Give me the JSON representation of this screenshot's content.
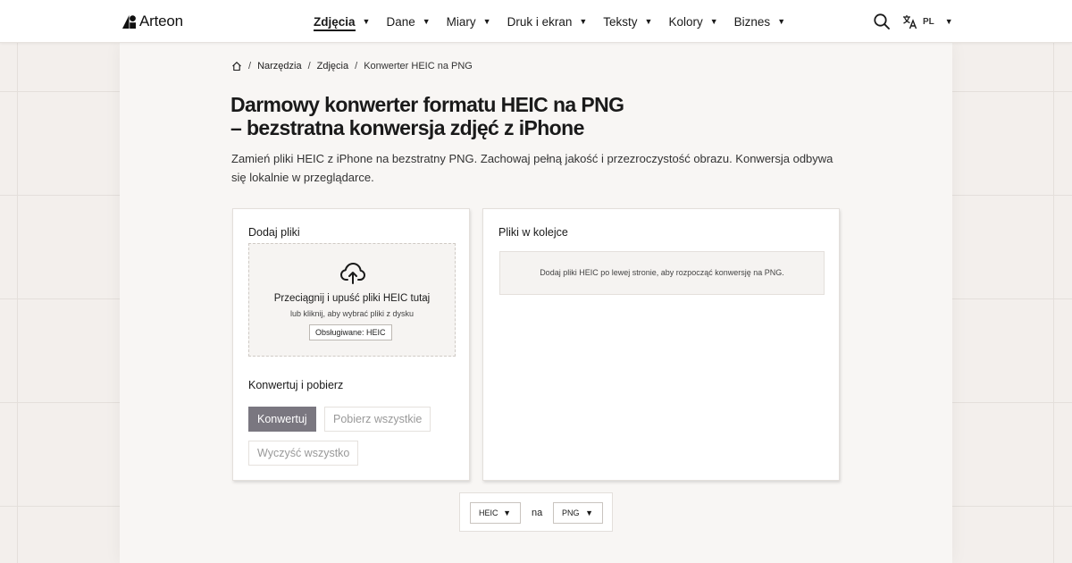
{
  "header": {
    "brand": "Arteon",
    "nav": [
      {
        "label": "Zdjęcia",
        "active": true
      },
      {
        "label": "Dane"
      },
      {
        "label": "Miary"
      },
      {
        "label": "Druk i ekran"
      },
      {
        "label": "Teksty"
      },
      {
        "label": "Kolory"
      },
      {
        "label": "Biznes"
      }
    ],
    "caret": "▼",
    "lang": "PL",
    "icons": [
      "logo-icon",
      "search-icon",
      "translate-icon",
      "home-icon",
      "upload-cloud-icon"
    ]
  },
  "breadcrumb": {
    "items": [
      "Narzędzia",
      "Zdjęcia"
    ],
    "current": "Konwerter HEIC na PNG",
    "separator": "/"
  },
  "page": {
    "title_line1": "Darmowy konwerter formatu HEIC na PNG",
    "title_line2": "– bezstratna konwersja zdjęć z iPhone",
    "lead": "Zamień pliki HEIC z iPhone na bezstratny PNG. Zachowaj pełną jakość i przezroczystość obrazu. Konwersja odbywa się lokalnie w przeglądarce."
  },
  "upload": {
    "title": "Dodaj pliki",
    "drop_main": "Przeciągnij i upuść pliki HEIC tutaj",
    "drop_sub": "lub kliknij, aby wybrać pliki z dysku",
    "supported": "Obsługiwane: HEIC"
  },
  "actions": {
    "title": "Konwertuj i pobierz",
    "convert": "Konwertuj",
    "download_all": "Pobierz wszystkie",
    "clear_all": "Wyczyść wszystko"
  },
  "queue": {
    "title": "Pliki w kolejce",
    "empty": "Dodaj pliki HEIC po lewej stronie, aby rozpocząć konwersję na PNG."
  },
  "format": {
    "from": "HEIC",
    "connector": "na",
    "to": "PNG"
  },
  "colors": {
    "primary_button": "#7a7780",
    "background": "#f3efec",
    "sheet": "#f8f6f4"
  }
}
